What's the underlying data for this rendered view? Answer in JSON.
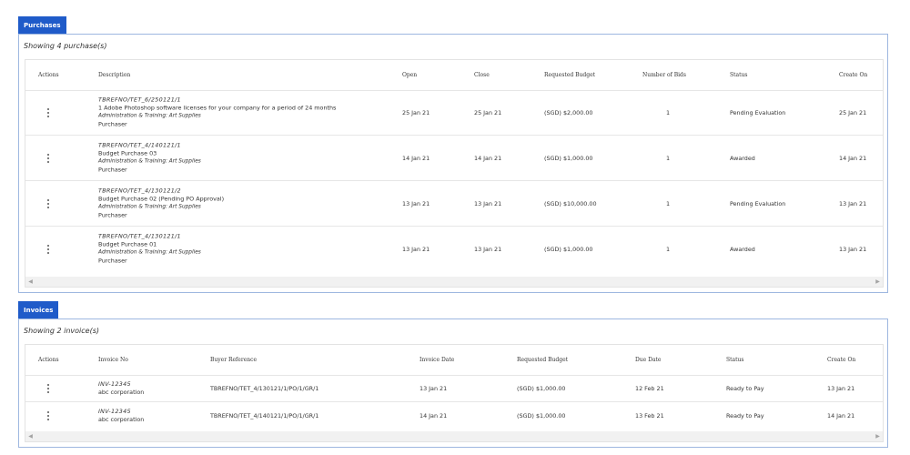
{
  "purchases": {
    "tab_label": "Purchases",
    "showing_text": "Showing 4 purchase(s)",
    "headers": {
      "actions": "Actions",
      "description": "Description",
      "open": "Open",
      "close": "Close",
      "requested_budget": "Requested Budget",
      "number_of_bids": "Number of Bids",
      "status": "Status",
      "create_on": "Create On"
    },
    "rows": [
      {
        "reference": "TBREFNO/TET_6/250121/1",
        "title": "1 Adobe Photoshop software licenses for your company for a period of 24 months",
        "category": "Administration & Training: Art Supplies",
        "role": "Purchaser",
        "open": "25 Jan 21",
        "close": "25 Jan 21",
        "requested_budget": "(SGD) $2,000.00",
        "number_of_bids": "1",
        "status": "Pending Evaluation",
        "create_on": "25 Jan 21"
      },
      {
        "reference": "TBREFNO/TET_4/140121/1",
        "title": "Budget Purchase 03",
        "category": "Administration & Training: Art Supplies",
        "role": "Purchaser",
        "open": "14 Jan 21",
        "close": "14 Jan 21",
        "requested_budget": "(SGD) $1,000.00",
        "number_of_bids": "1",
        "status": "Awarded",
        "create_on": "14 Jan 21"
      },
      {
        "reference": "TBREFNO/TET_4/130121/2",
        "title": "Budget Purchase 02 (Pending PO Approval)",
        "category": "Administration & Training: Art Supplies",
        "role": "Purchaser",
        "open": "13 Jan 21",
        "close": "13 Jan 21",
        "requested_budget": "(SGD) $10,000.00",
        "number_of_bids": "1",
        "status": "Pending Evaluation",
        "create_on": "13 Jan 21"
      },
      {
        "reference": "TBREFNO/TET_4/130121/1",
        "title": "Budget Purchase 01",
        "category": "Administration & Training: Art Supplies",
        "role": "Purchaser",
        "open": "13 Jan 21",
        "close": "13 Jan 21",
        "requested_budget": "(SGD) $1,000.00",
        "number_of_bids": "1",
        "status": "Awarded",
        "create_on": "13 Jan 21"
      }
    ]
  },
  "invoices": {
    "tab_label": "Invoices",
    "showing_text": "Showing 2 invoice(s)",
    "headers": {
      "actions": "Actions",
      "invoice_no": "Invoice No",
      "buyer_reference": "Buyer Reference",
      "invoice_date": "Invoice Date",
      "requested_budget": "Requested Budget",
      "due_date": "Due Date",
      "status": "Status",
      "create_on": "Create On"
    },
    "rows": [
      {
        "invoice_no": "INV-12345",
        "company": "abc corporation",
        "buyer_reference": "TBREFNO/TET_4/130121/1/PO/1/GR/1",
        "invoice_date": "13 Jan 21",
        "requested_budget": "(SGD) $1,000.00",
        "due_date": "12 Feb 21",
        "status": "Ready to Pay",
        "create_on": "13 Jan 21"
      },
      {
        "invoice_no": "INV-12345",
        "company": "abc corporation",
        "buyer_reference": "TBREFNO/TET_4/140121/1/PO/1/GR/1",
        "invoice_date": "14 Jan 21",
        "requested_budget": "(SGD) $1,000.00",
        "due_date": "13 Feb 21",
        "status": "Ready to Pay",
        "create_on": "14 Jan 21"
      }
    ]
  },
  "icons": {
    "actions": "kebab-menu-icon",
    "scroll_left": "chevron-left-icon",
    "scroll_right": "chevron-right-icon"
  },
  "colors": {
    "tab_background": "#1f5bc9",
    "panel_border": "#9eb7e0"
  }
}
